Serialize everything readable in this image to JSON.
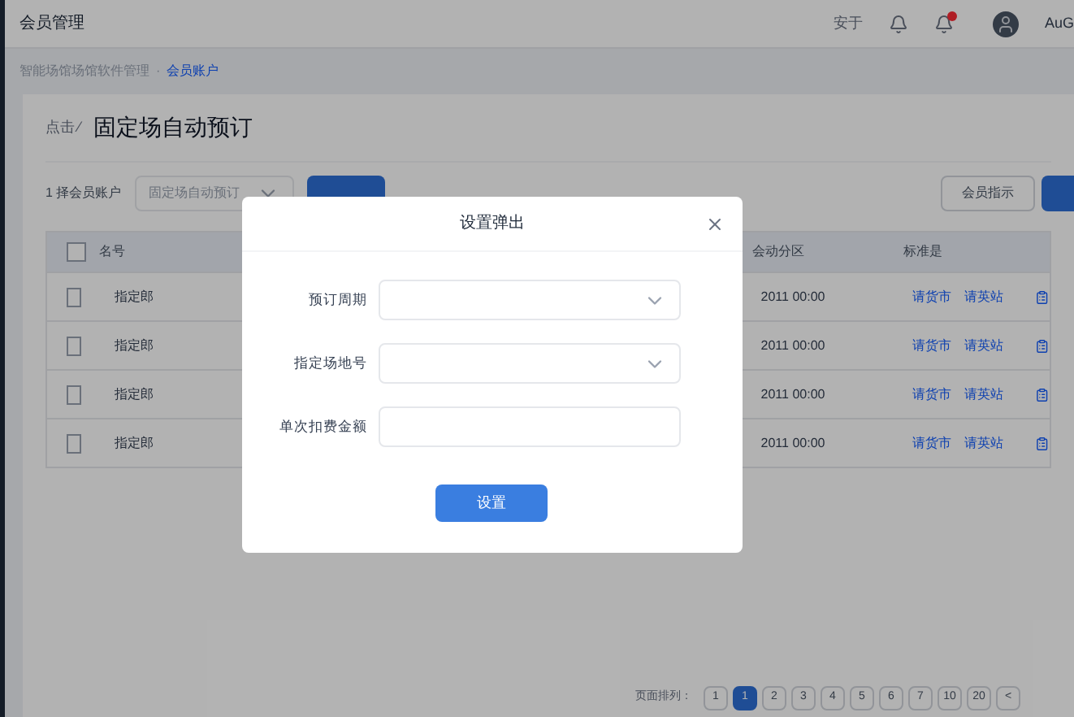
{
  "app_title": "会员管理",
  "header": {
    "user_menu": "安于",
    "notification_dot": true,
    "username": "AuG"
  },
  "breadcrumb_separator": "·",
  "breadcrumb": [
    {
      "label": "智能场馆场馆软件管理",
      "selected": false
    },
    {
      "label": "会员账户",
      "selected": true
    }
  ],
  "page": {
    "back": "点击",
    "back_mark": "⁄",
    "title": "固定场自动预订"
  },
  "filter": {
    "label": "1 择会员账户",
    "select_value": "固定场自动预订",
    "secondary_button": "会员指示"
  },
  "table": {
    "all_checked": false,
    "columns": [
      "名号",
      "会动分区",
      "标准是"
    ],
    "rows": [
      {
        "checked": false,
        "name": "指定郎",
        "time": "2011 00:00",
        "links": [
          "请货市",
          "请英站"
        ]
      },
      {
        "checked": false,
        "name": "指定郎",
        "time": "2011 00:00",
        "links": [
          "请货市",
          "请英站"
        ]
      },
      {
        "checked": false,
        "name": "指定郎",
        "time": "2011 00:00",
        "links": [
          "请货市",
          "请英站"
        ]
      },
      {
        "checked": false,
        "name": "指定郎",
        "time": "2011 00:00",
        "links": [
          "请货市",
          "请英站"
        ]
      }
    ]
  },
  "pagination": {
    "label": "页面排列：",
    "pages": [
      {
        "label": "1",
        "selected": false
      },
      {
        "label": "1",
        "selected": true
      },
      {
        "label": "2",
        "selected": false
      },
      {
        "label": "3",
        "selected": false
      },
      {
        "label": "4",
        "selected": false
      },
      {
        "label": "5",
        "selected": false
      },
      {
        "label": "6",
        "selected": false
      },
      {
        "label": "7",
        "selected": false
      },
      {
        "label": "10",
        "selected": false
      },
      {
        "label": "20",
        "selected": false
      },
      {
        "label": "<",
        "selected": false
      }
    ]
  },
  "dialog": {
    "title": "设置弹出",
    "fields": [
      {
        "kind": "select",
        "label": "预订周期"
      },
      {
        "kind": "select",
        "label": "指定场地号"
      },
      {
        "kind": "input",
        "label": "单次扣费金额"
      }
    ],
    "button": "设置"
  }
}
